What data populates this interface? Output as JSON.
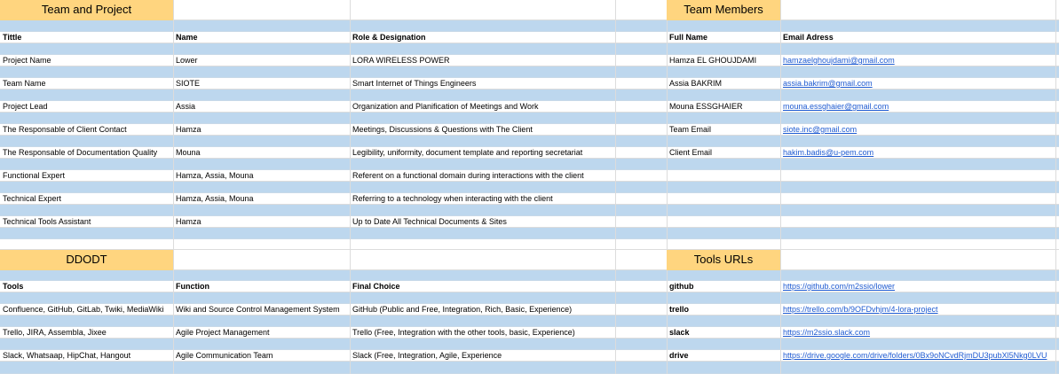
{
  "sections": {
    "team_project": "Team and Project",
    "team_members": "Team Members",
    "ddodt": "DDODT",
    "tools_urls": "Tools URLs"
  },
  "team_table": {
    "headers": [
      "Tittle",
      "Name",
      "Role & Designation"
    ],
    "rows": [
      [
        "Project Name",
        "Lower",
        " LORA WIRELESS POWER"
      ],
      [
        "Team Name",
        "SIOTE",
        "Smart Internet of Things Engineers"
      ],
      [
        "Project Lead",
        "Assia",
        "Organization and Planification of Meetings and Work"
      ],
      [
        "The Responsable of Client Contact",
        "Hamza",
        "Meetings, Discussions & Questions with The Client"
      ],
      [
        "The Responsable of Documentation Quality",
        "Mouna",
        "Legibility, uniformity, document template and reporting secretariat"
      ],
      [
        "Functional Expert",
        "Hamza, Assia, Mouna",
        "Referent on a functional domain during interactions with the client"
      ],
      [
        "Technical Expert",
        "Hamza, Assia, Mouna",
        "Referring to a technology when interacting with the client"
      ],
      [
        "Technical Tools Assistant",
        "Hamza",
        "Up to Date All Technical Documents  & Sites"
      ]
    ]
  },
  "members_table": {
    "headers": [
      "Full Name",
      "Email Adress"
    ],
    "rows": [
      [
        "Hamza EL GHOUJDAMI",
        "hamzaelghoujdami@gmail.com"
      ],
      [
        "Assia BAKRIM",
        "assia.bakrim@gmail.com"
      ],
      [
        "Mouna ESSGHAIER",
        "mouna.essghaier@gmail.com"
      ],
      [
        "Team Email",
        "siote.inc@gmail.com"
      ],
      [
        "Client Email",
        "hakim.badis@u-pem.com"
      ]
    ]
  },
  "ddodt_table": {
    "headers": [
      "Tools",
      "Function",
      "Final Choice"
    ],
    "rows": [
      [
        "Confluence, GitHub, GitLab, Twiki, MediaWiki",
        "Wiki and Source Control Management System",
        "GitHub (Public and Free, Integration, Rich, Basic, Experience)"
      ],
      [
        "Trello, JIRA, Assembla, Jixee",
        "Agile Project Management",
        "Trello (Free, Integration with the other tools, basic, Experience)"
      ],
      [
        "Slack, Whatsaap, HipChat, Hangout",
        "Agile Communication Team",
        "Slack (Free, Integration, Agile, Experience"
      ]
    ]
  },
  "tools_table": {
    "rows": [
      [
        "github",
        "https://github.com/m2ssio/lower"
      ],
      [
        "trello",
        "https://trello.com/b/9OFDvhjm/4-lora-project"
      ],
      [
        "slack",
        "https://m2ssio.slack.com"
      ],
      [
        "drive",
        "https://drive.google.com/drive/folders/0Bx9oNCvdRjmDU3pubXl5Nkg0LVU"
      ]
    ]
  },
  "colors": {
    "header_bg": "#ffd57f",
    "stripe": "#bdd7ee",
    "link": "#1f5bd1"
  }
}
